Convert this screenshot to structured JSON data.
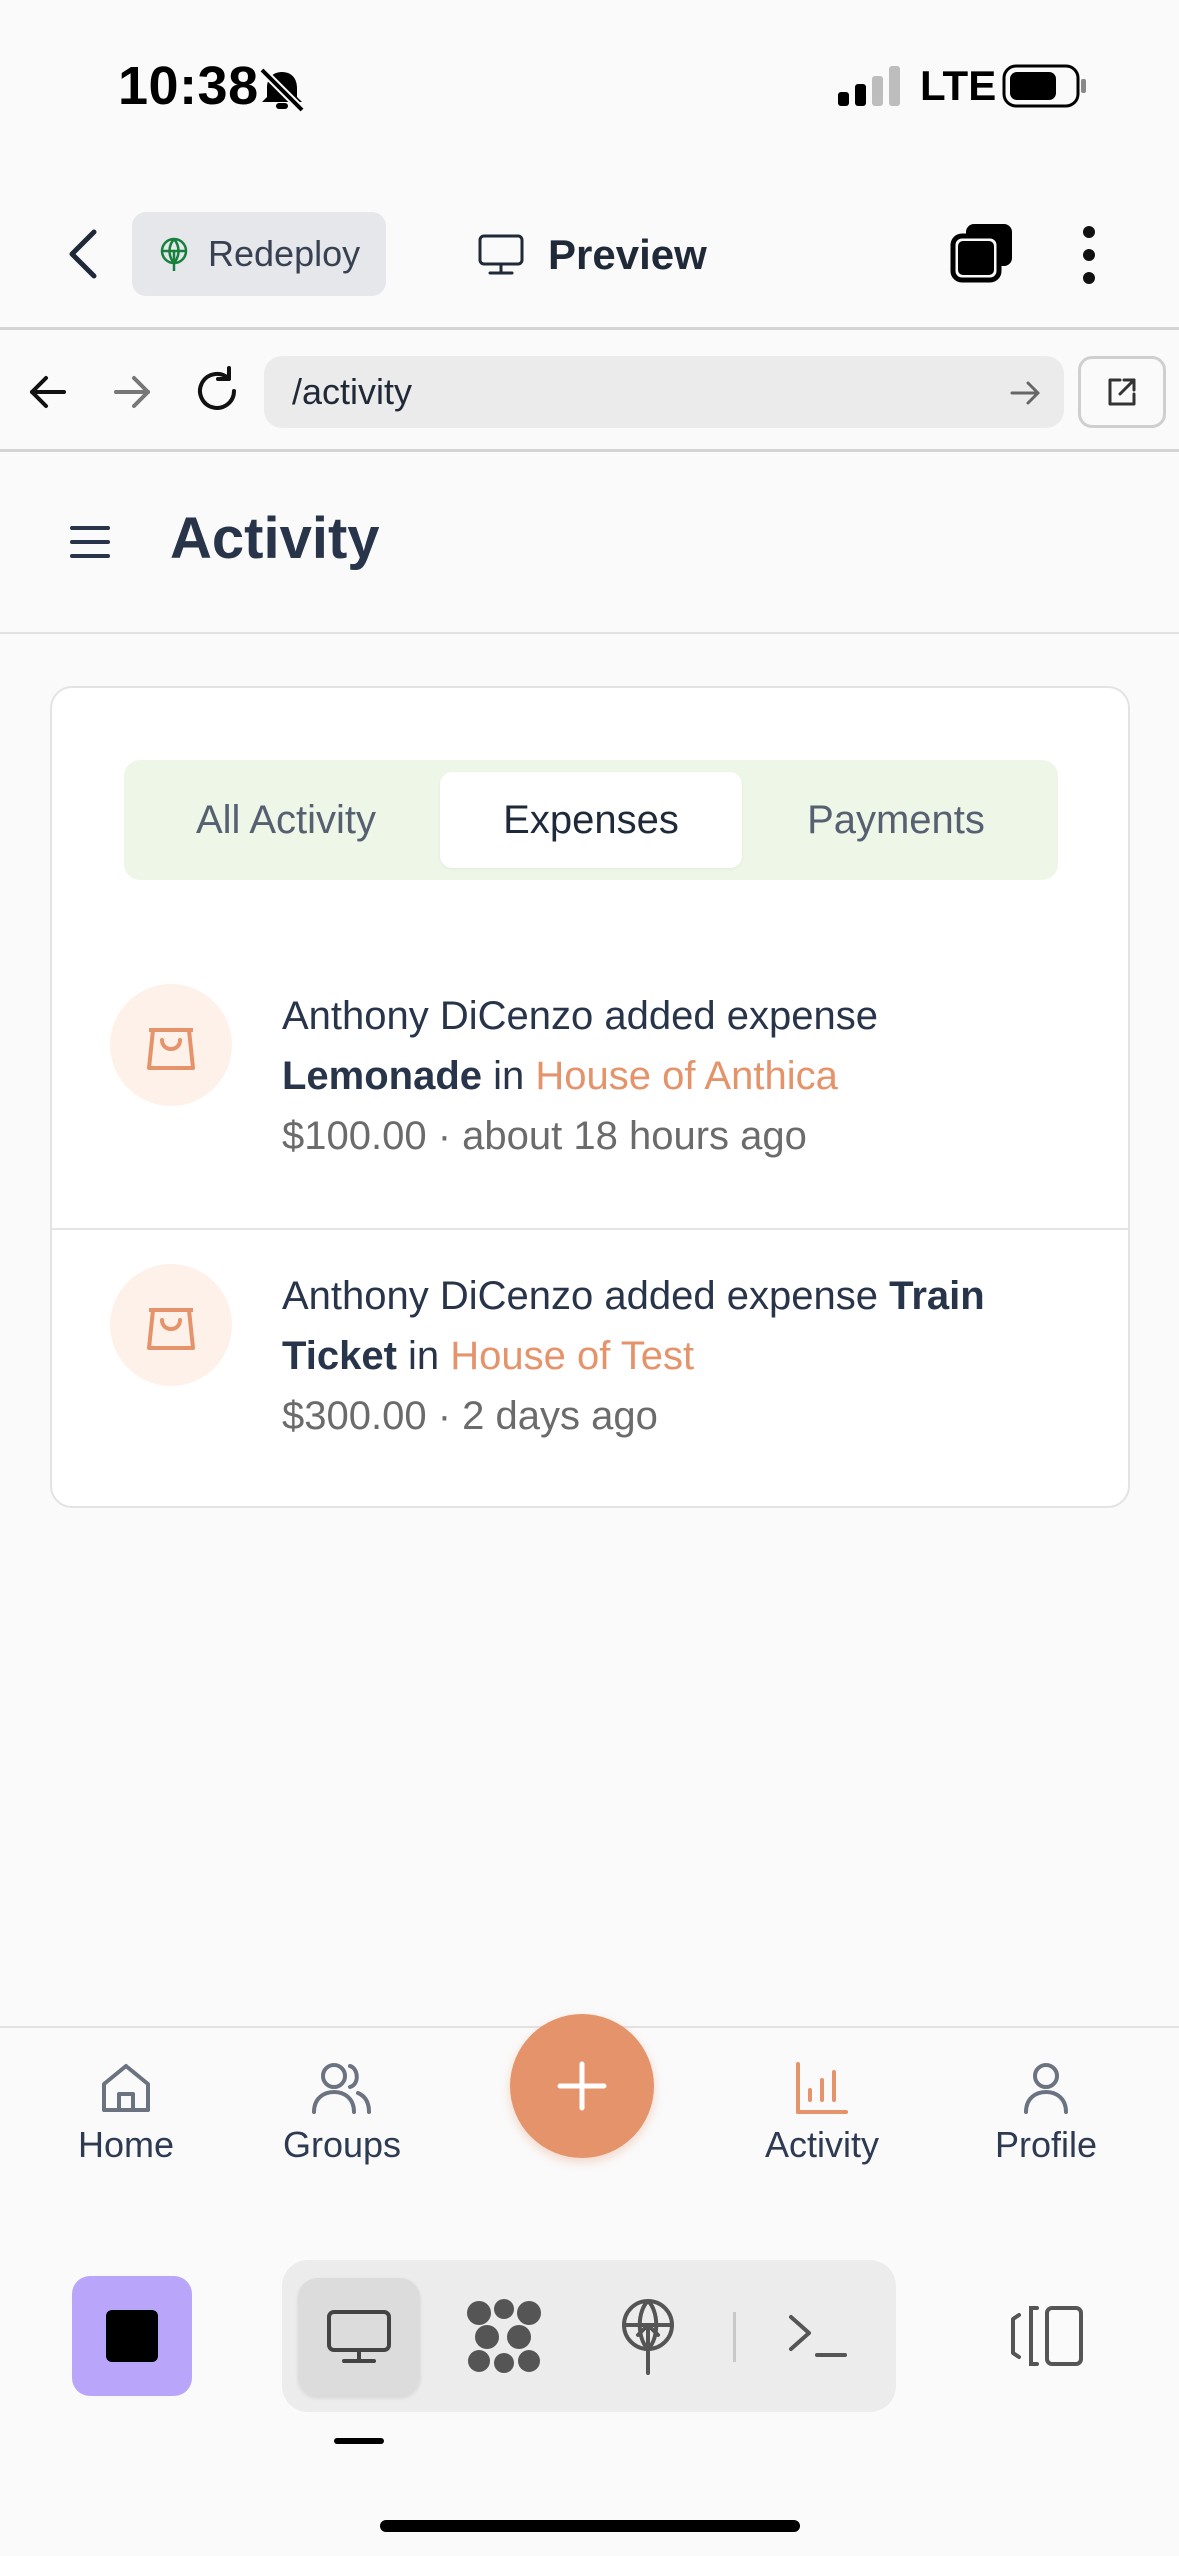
{
  "status_bar": {
    "time": "10:38",
    "network": "LTE"
  },
  "header": {
    "redeploy_label": "Redeploy",
    "preview_label": "Preview",
    "url": "/activity"
  },
  "page": {
    "title": "Activity"
  },
  "tabs": [
    {
      "label": "All Activity",
      "active": false
    },
    {
      "label": "Expenses",
      "active": true
    },
    {
      "label": "Payments",
      "active": false
    }
  ],
  "activities": [
    {
      "user": "Anthony DiCenzo",
      "action": " added expense ",
      "item": "Lemonade",
      "connector": " in ",
      "group": "House of Anthica",
      "meta": "$100.00 · about 18 hours ago"
    },
    {
      "user": "Anthony DiCenzo",
      "action": " added expense ",
      "item": "Train Ticket",
      "connector": " in ",
      "group": "House of Test",
      "meta": "$300.00 · 2 days ago"
    }
  ],
  "bottom_nav": [
    {
      "label": "Home",
      "icon": "home-icon"
    },
    {
      "label": "Groups",
      "icon": "users-icon"
    },
    {
      "label": "Activity",
      "icon": "bar-chart-icon",
      "active": true
    },
    {
      "label": "Profile",
      "icon": "user-icon"
    }
  ],
  "colors": {
    "accent": "#e5936a",
    "tab_bg": "#eef6e8",
    "stop_button": "#b9a6fb",
    "text_dark": "#273449"
  }
}
